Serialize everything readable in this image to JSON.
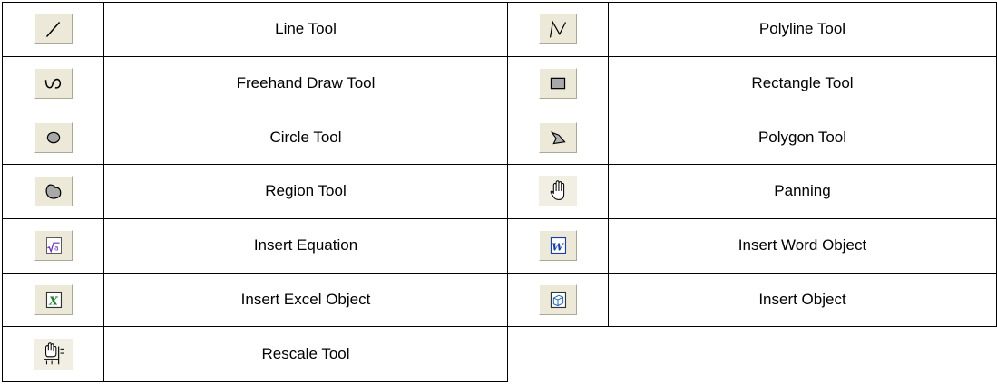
{
  "tools": [
    {
      "left": {
        "icon": "line-icon",
        "label": "Line Tool"
      },
      "right": {
        "icon": "polyline-icon",
        "label": "Polyline Tool"
      }
    },
    {
      "left": {
        "icon": "freehand-icon",
        "label": "Freehand Draw Tool"
      },
      "right": {
        "icon": "rectangle-icon",
        "label": "Rectangle Tool"
      }
    },
    {
      "left": {
        "icon": "circle-icon",
        "label": "Circle Tool"
      },
      "right": {
        "icon": "polygon-icon",
        "label": "Polygon Tool"
      }
    },
    {
      "left": {
        "icon": "region-icon",
        "label": "Region Tool"
      },
      "right": {
        "icon": "hand-icon",
        "label": "Panning"
      }
    },
    {
      "left": {
        "icon": "equation-icon",
        "label": "Insert Equation"
      },
      "right": {
        "icon": "word-object-icon",
        "label": "Insert Word Object"
      }
    },
    {
      "left": {
        "icon": "excel-object-icon",
        "label": "Insert Excel Object"
      },
      "right": {
        "icon": "insert-object-icon",
        "label": "Insert Object"
      }
    },
    {
      "left": {
        "icon": "rescale-icon",
        "label": "Rescale Tool"
      },
      "right": null
    }
  ]
}
